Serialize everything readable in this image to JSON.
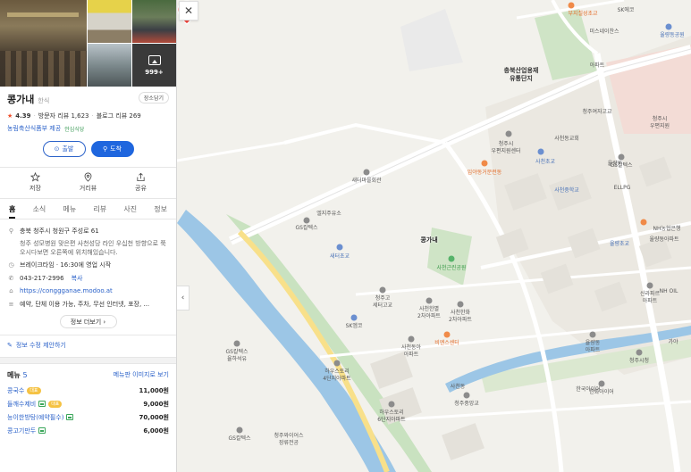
{
  "place": {
    "name": "콩가내",
    "category": "한식",
    "save_label": "장소담기",
    "rating": "4.39",
    "visitor_reviews": "방문자 리뷰 1,623",
    "blog_reviews": "블로그 리뷰 269",
    "provider": "농림축산식품부 제공",
    "provider_tag": "안심식당",
    "photo_count": "999+"
  },
  "buttons": {
    "depart": "출발",
    "arrive": "도착"
  },
  "actions": {
    "save": "저장",
    "distance": "거리뷰",
    "share": "공유"
  },
  "tabs": [
    "홈",
    "소식",
    "메뉴",
    "리뷰",
    "사진",
    "정보"
  ],
  "info": {
    "address": "충북 청주시 청원구 주성로 61",
    "directions": "청주 성모병원 맞은편 사천성당 라인 우십천 방향으로 쭉 오시다보면 오른쪽에 위치해있습니다.",
    "hours": "브레이크타임 · 16:30에 영업 시작",
    "phone": "043-217-2996",
    "copy_label": "복사",
    "website": "https://conggganae.modoo.at",
    "amenities": "예약, 단체 이용 가능, 주차, 무선 인터넷, 포장, ...",
    "more_label": "정보 더보기",
    "suggest_label": "정보 수정 제안하기"
  },
  "menu": {
    "title": "메뉴",
    "count": "5",
    "view_image_label": "메뉴판 이미지로 보기",
    "badge": "대표",
    "items": [
      {
        "name": "콩국수",
        "price": "11,000원"
      },
      {
        "name": "들깨수제비",
        "price": "9,000원"
      },
      {
        "name": "능이한방탕(예약필수)",
        "price": "70,000원"
      },
      {
        "name": "콩고기만두",
        "price": "6,000원"
      }
    ]
  },
  "map": {
    "main_pin_label": "콩가내",
    "labels": [
      {
        "t": "부지칠성초교",
        "c": "orange"
      },
      {
        "t": "SK에코",
        "c": ""
      },
      {
        "t": "미스네이찬스",
        "c": ""
      },
      {
        "t": "율량동공원",
        "c": "blue"
      },
      {
        "t": "충북산업용재\n유통단지",
        "c": "dark"
      },
      {
        "t": "아파트",
        "c": ""
      },
      {
        "t": "청주시\n우편지원센터",
        "c": ""
      },
      {
        "t": "사천초교",
        "c": "blue"
      },
      {
        "t": "청주여자고교",
        "c": ""
      },
      {
        "t": "사천동교회",
        "c": ""
      },
      {
        "t": "새터마을회관",
        "c": ""
      },
      {
        "t": "입야동거문런동",
        "c": "orange"
      },
      {
        "t": "사천중학교",
        "c": "blue"
      },
      {
        "t": "율량동",
        "c": ""
      },
      {
        "t": "GS칼텍스",
        "c": ""
      },
      {
        "t": "엘지주유소",
        "c": ""
      },
      {
        "t": "사천근린공원",
        "c": "green"
      },
      {
        "t": "새터초교",
        "c": "blue"
      },
      {
        "t": "청주고\n세터고교",
        "c": ""
      },
      {
        "t": "사천한별\n2차아파트",
        "c": ""
      },
      {
        "t": "사천한화\n2차아파트",
        "c": ""
      },
      {
        "t": "SK엠코",
        "c": ""
      },
      {
        "t": "비엔스센터",
        "c": ""
      },
      {
        "t": "GS칼텍스\n율하석유",
        "c": ""
      },
      {
        "t": "사천동아\n아파트",
        "c": ""
      },
      {
        "t": "청주중앙교",
        "c": ""
      },
      {
        "t": "하우스토리\n4단지아파트",
        "c": ""
      },
      {
        "t": "하우스토리\n6단지아파트",
        "c": ""
      },
      {
        "t": "GS칼텍스",
        "c": ""
      },
      {
        "t": "청주와이어스\n장류전공",
        "c": ""
      },
      {
        "t": "사천동",
        "c": ""
      },
      {
        "t": "한화아이어",
        "c": ""
      },
      {
        "t": "율량초교",
        "c": "blue"
      },
      {
        "t": "NH농협은행",
        "c": ""
      },
      {
        "t": "율량동아파트",
        "c": ""
      },
      {
        "t": "ELLPG",
        "c": ""
      },
      {
        "t": "GS칼텍스",
        "c": ""
      },
      {
        "t": "신라파르\n아파트",
        "c": ""
      },
      {
        "t": "NH OIL",
        "c": ""
      },
      {
        "t": "한국아이어",
        "c": ""
      },
      {
        "t": "율량동\n아파트",
        "c": ""
      },
      {
        "t": "청주시\n우편지원",
        "c": ""
      },
      {
        "t": "가야",
        "c": ""
      },
      {
        "t": "청주시청",
        "c": ""
      }
    ]
  },
  "icons": {
    "close": "close-icon",
    "collapse": "chevron-left-icon"
  }
}
